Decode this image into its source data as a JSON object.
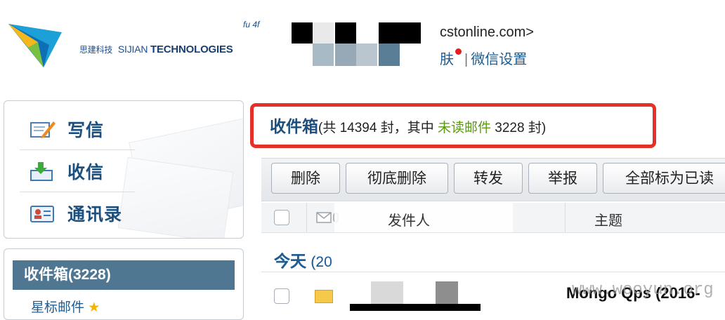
{
  "header": {
    "logo": {
      "company_cn": "思建科技",
      "company_en_prefix": "SIJIAN",
      "company_en_suffix": "TECHNOLOGIES",
      "script_text": "fu 4f"
    },
    "user_email": "cstonline.com>",
    "links": [
      "肤",
      "微信设置"
    ]
  },
  "sidebar": {
    "actions": [
      {
        "label": "写信",
        "icon": "compose-icon"
      },
      {
        "label": "收信",
        "icon": "receive-icon"
      },
      {
        "label": "通讯录",
        "icon": "contacts-icon"
      }
    ],
    "folders": {
      "active": "收件箱(3228)",
      "starred": "星标邮件",
      "starred_icon": "star-icon"
    }
  },
  "main": {
    "title": {
      "folder": "收件箱",
      "prefix": "(共 14394 封，其中 ",
      "unread_link": "未读邮件",
      "suffix": " 3228 封)"
    },
    "toolbar": {
      "buttons": [
        "删除",
        "彻底删除",
        "转发",
        "举报",
        "全部标为已读"
      ]
    },
    "columns": {
      "sender": "发件人",
      "subject": "主题"
    },
    "group": {
      "label": "今天",
      "count": "(20"
    },
    "rows": [
      {
        "subject": "Mongo Qps (2016-",
        "watermark": "www.wooyun.org"
      }
    ]
  },
  "colors": {
    "highlight_border": "#e5302a",
    "accent_blue": "#1d4f7e",
    "unread_green": "#5a9a12",
    "active_folder_bg": "#4f7792"
  }
}
